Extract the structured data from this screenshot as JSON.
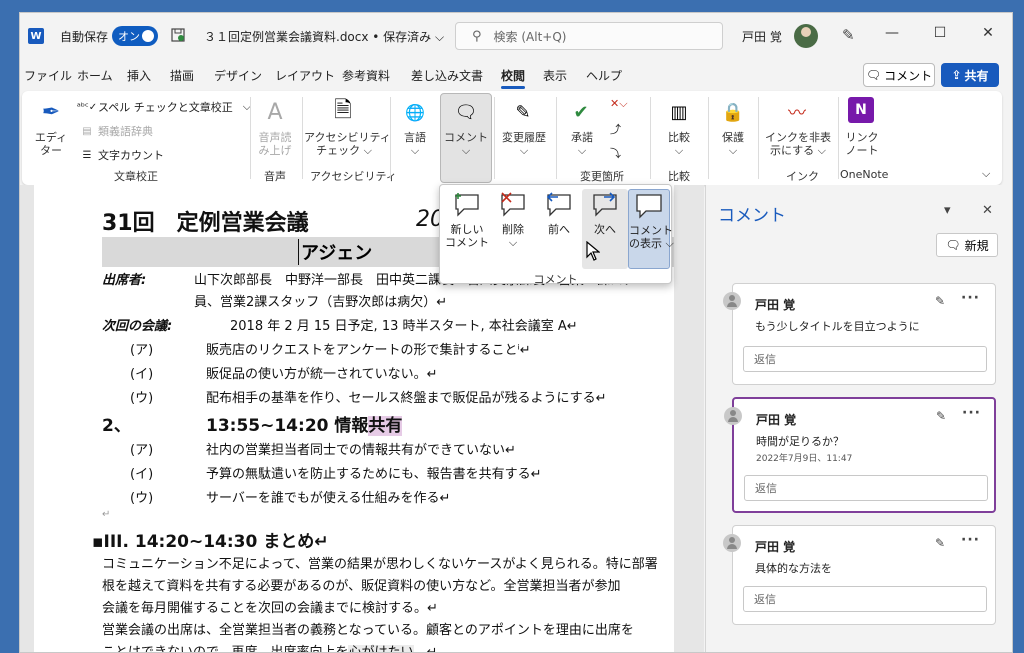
{
  "titlebar": {
    "app_icon": "W",
    "autosave_label": "自動保存",
    "autosave_state": "オン",
    "doc_title": "３１回定例営業会議資料.docx • 保存済み ⌵",
    "search_placeholder": "検索 (Alt+Q)",
    "user_name": "戸田 覚",
    "minimize": "—",
    "maximize": "☐",
    "close": "✕"
  },
  "tabs": [
    "ファイル",
    "ホーム",
    "挿入",
    "描画",
    "デザイン",
    "レイアウト",
    "参考資料",
    "差し込み文書",
    "校閲",
    "表示",
    "ヘルプ"
  ],
  "active_tab": "校閲",
  "top_buttons": {
    "comment": "コメント",
    "share": "共有"
  },
  "ribbon": {
    "editor": "エディ\nター",
    "spell": "スペル チェックと文章校正",
    "thesaurus": "類義語辞典",
    "wordcount": "文字カウント",
    "group_proofing": "文章校正",
    "read_aloud": "音声読\nみ上げ",
    "group_speech": "音声",
    "accessibility": "アクセシビリティ\nチェック ⌵",
    "group_accessibility": "アクセシビリティ",
    "language": "言語\n⌵",
    "comment": "コメント\n⌵",
    "track_changes": "変更履歴\n⌵",
    "accept": "承諾\n⌵",
    "group_changes": "変更箇所",
    "compare": "比較\n⌵",
    "group_compare": "比較",
    "protect": "保護\n⌵",
    "hide_ink": "インクを非表\n示にする ⌵",
    "group_ink": "インク",
    "onenote": "リンク\nノート",
    "group_onenote": "OneNote"
  },
  "comment_menu": {
    "new": "新しい\nコメント",
    "delete": "削除\n⌵",
    "prev": "前へ",
    "next": "次へ",
    "show": "コメント\nの表示 ⌵",
    "group": "コメント"
  },
  "document": {
    "title": "31回　定例営業会議",
    "title_right": "20",
    "agenda": "アジェン",
    "attendees_label": "出席者:",
    "attendees_1": "山下次郎部長　中野洋一部長　田中英二課長　吉川美京課長　営業１課スタ",
    "attendees_2": "員、営業2課スタッフ（吉野次郎は病欠）↵",
    "next_label": "次回の会議:",
    "next_text": "2018 年 2 月 15 日予定, 13 時半スタート, 本社会議室 A↵",
    "item_a1_label": "(ア)",
    "item_a1": "販売店のリクエストをアンケートの形で集計することⁱ↵",
    "item_i1_label": "(イ)",
    "item_i1": "販促品の使い方が統一されていない。↵",
    "item_u1_label": "(ウ)",
    "item_u1": "配布相手の基準を作り、セールス終盤まで販促品が残るようにする↵",
    "sec2_num": "2、",
    "sec2_title": "13:55~14:20 情報",
    "sec2_hl": "共有",
    "item_a2_label": "(ア)",
    "item_a2": "社内の営業担当者同士での情報共有ができていない↵",
    "item_i2_label": "(イ)",
    "item_i2": "予算の無駄遣いを防止するためにも、報告書を共有する↵",
    "item_u2_label": "(ウ)",
    "item_u2": "サーバーを誰でもが使える仕組みを作る↵",
    "empty_mark": "↵",
    "sec3": "▪III.  14:20~14:30 まとめ↵",
    "p1": "コミュニケーション不足によって、営業の結果が思わしくないケースがよく見られる。特に部署",
    "p2": "根を越えて資料を共有する必要があるのが、販促資料の使い方など。全営業担当者が参加",
    "p3": "会議を毎月開催することを次回の会議までに検討する。↵",
    "p4": "営業会議の出席は、全営業担当者の義務となっている。顧客とのアポイントを理由に出席を",
    "p5": "ことはできないので、再度、出席率向上を",
    "p5_hl": "心がけたい",
    "p5_end": "。↵",
    "p6": "↵"
  },
  "comments_pane": {
    "title": "コメント",
    "dropdown": "▾",
    "close": "✕",
    "new_button": "新規",
    "comments": [
      {
        "author": "戸田 覚",
        "text": "もう少しタイトルを目立つように",
        "date": "",
        "reply": "返信"
      },
      {
        "author": "戸田 覚",
        "text": "時間が足りるか？",
        "date": "2022年7月9日、11:47",
        "reply": "返信"
      },
      {
        "author": "戸田 覚",
        "text": "具体的な方法を",
        "date": "",
        "reply": "返信"
      }
    ]
  },
  "colors": {
    "accent": "#185abd",
    "active_comment_border": "#7f3f9a",
    "highlight": "#e6cbe6"
  }
}
